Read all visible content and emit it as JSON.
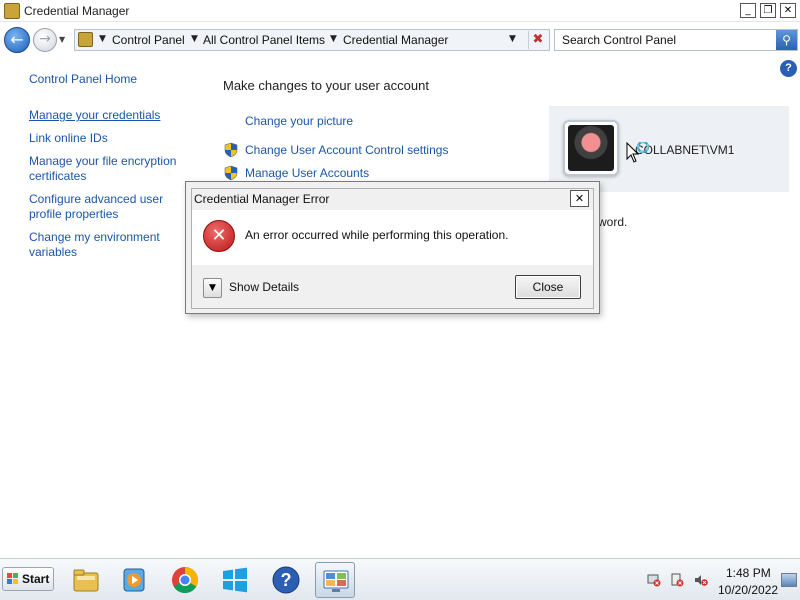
{
  "window": {
    "title": "Credential Manager",
    "controls": {
      "minimize": "_",
      "maximize": "❐",
      "close": "✕"
    }
  },
  "address_bar": {
    "breadcrumbs": [
      "Control Panel",
      "All Control Panel Items",
      "Credential Manager"
    ],
    "search_placeholder": "Search Control Panel"
  },
  "left_nav": {
    "home": "Control Panel Home",
    "items": [
      "Manage your credentials",
      "Link online IDs",
      "Manage your file encryption certificates",
      "Configure advanced user profile properties",
      "Change my environment variables"
    ]
  },
  "main": {
    "heading": "Make changes to your user account",
    "tasks": [
      {
        "label": "Change your picture",
        "shield": false
      },
      {
        "label": "Change User Account Control settings",
        "shield": true
      },
      {
        "label": "Manage User Accounts",
        "shield": true
      }
    ],
    "partial_text": "word."
  },
  "user_tile": {
    "name": "COLLABNET\\VM1"
  },
  "dialog": {
    "title": "Credential Manager Error",
    "message": "An error occurred while performing this operation.",
    "details_label": "Show Details",
    "close_button": "Close",
    "close_icon": "close-icon",
    "icon": "error-icon"
  },
  "taskbar": {
    "start_label": "Start",
    "apps": [
      "file-explorer-icon",
      "media-player-icon",
      "chrome-icon",
      "windows-logo-icon",
      "help-icon",
      "control-panel-icon"
    ],
    "clock_time": "1:48 PM",
    "clock_date": "10/20/2022"
  },
  "colors": {
    "link": "#1a56a8",
    "error_red": "#b81818",
    "shield_blue": "#2b5fb4",
    "shield_yellow": "#f0c419"
  }
}
